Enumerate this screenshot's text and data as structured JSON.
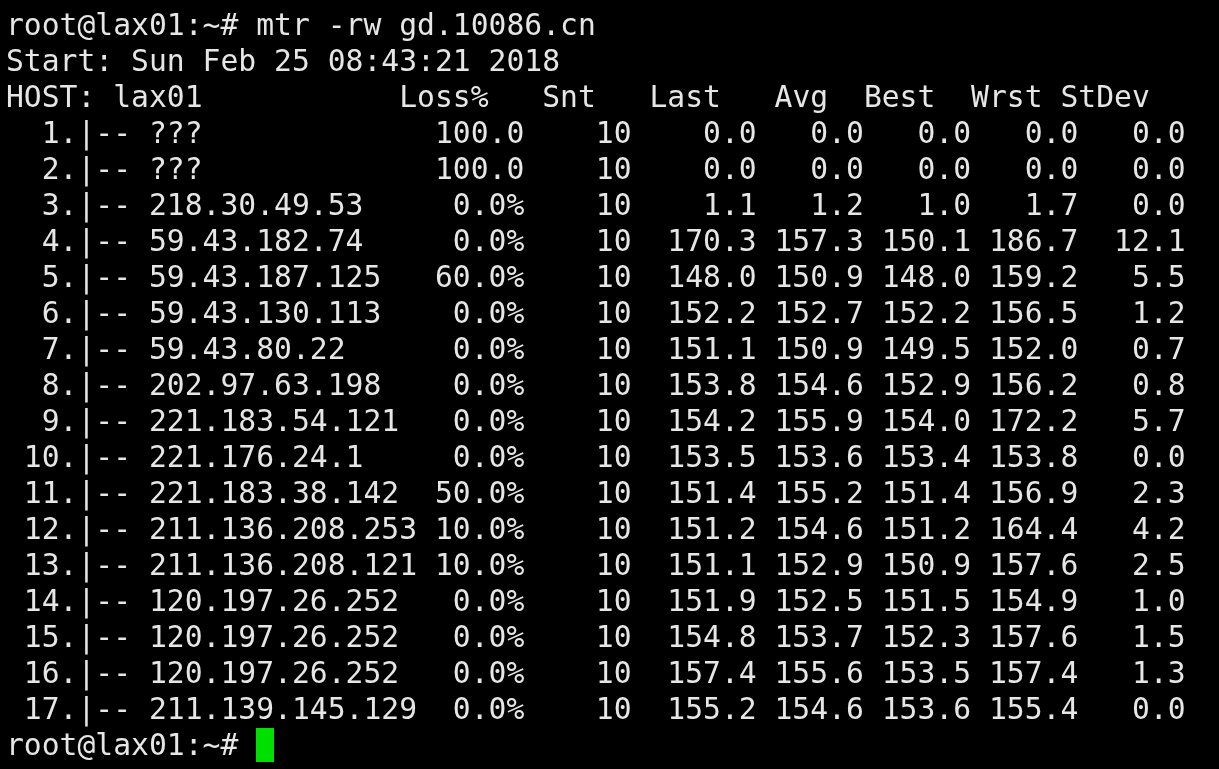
{
  "terminal": {
    "lines": [
      {
        "kind": "command",
        "prompt": "root@lax01:~#",
        "command": "mtr -rw gd.10086.cn"
      },
      {
        "kind": "text",
        "text": "Start: Sun Feb 25 08:43:21 2018"
      }
    ],
    "report": {
      "host_label": "HOST: lax01",
      "columns": [
        "Loss%",
        "Snt",
        "Last",
        "Avg",
        "Best",
        "Wrst",
        "StDev"
      ],
      "rows": [
        {
          "hop": "1.|--",
          "host": "???",
          "values": [
            "100.0",
            "10",
            "0.0",
            "0.0",
            "0.0",
            "0.0",
            "0.0"
          ]
        },
        {
          "hop": "2.|--",
          "host": "???",
          "values": [
            "100.0",
            "10",
            "0.0",
            "0.0",
            "0.0",
            "0.0",
            "0.0"
          ]
        },
        {
          "hop": "3.|--",
          "host": "218.30.49.53",
          "values": [
            "0.0%",
            "10",
            "1.1",
            "1.2",
            "1.0",
            "1.7",
            "0.0"
          ]
        },
        {
          "hop": "4.|--",
          "host": "59.43.182.74",
          "values": [
            "0.0%",
            "10",
            "170.3",
            "157.3",
            "150.1",
            "186.7",
            "12.1"
          ]
        },
        {
          "hop": "5.|--",
          "host": "59.43.187.125",
          "values": [
            "60.0%",
            "10",
            "148.0",
            "150.9",
            "148.0",
            "159.2",
            "5.5"
          ]
        },
        {
          "hop": "6.|--",
          "host": "59.43.130.113",
          "values": [
            "0.0%",
            "10",
            "152.2",
            "152.7",
            "152.2",
            "156.5",
            "1.2"
          ]
        },
        {
          "hop": "7.|--",
          "host": "59.43.80.22",
          "values": [
            "0.0%",
            "10",
            "151.1",
            "150.9",
            "149.5",
            "152.0",
            "0.7"
          ]
        },
        {
          "hop": "8.|--",
          "host": "202.97.63.198",
          "values": [
            "0.0%",
            "10",
            "153.8",
            "154.6",
            "152.9",
            "156.2",
            "0.8"
          ]
        },
        {
          "hop": "9.|--",
          "host": "221.183.54.121",
          "values": [
            "0.0%",
            "10",
            "154.2",
            "155.9",
            "154.0",
            "172.2",
            "5.7"
          ]
        },
        {
          "hop": "10.|--",
          "host": "221.176.24.1",
          "values": [
            "0.0%",
            "10",
            "153.5",
            "153.6",
            "153.4",
            "153.8",
            "0.0"
          ]
        },
        {
          "hop": "11.|--",
          "host": "221.183.38.142",
          "values": [
            "50.0%",
            "10",
            "151.4",
            "155.2",
            "151.4",
            "156.9",
            "2.3"
          ]
        },
        {
          "hop": "12.|--",
          "host": "211.136.208.253",
          "values": [
            "10.0%",
            "10",
            "151.2",
            "154.6",
            "151.2",
            "164.4",
            "4.2"
          ]
        },
        {
          "hop": "13.|--",
          "host": "211.136.208.121",
          "values": [
            "10.0%",
            "10",
            "151.1",
            "152.9",
            "150.9",
            "157.6",
            "2.5"
          ]
        },
        {
          "hop": "14.|--",
          "host": "120.197.26.252",
          "values": [
            "0.0%",
            "10",
            "151.9",
            "152.5",
            "151.5",
            "154.9",
            "1.0"
          ]
        },
        {
          "hop": "15.|--",
          "host": "120.197.26.252",
          "values": [
            "0.0%",
            "10",
            "154.8",
            "153.7",
            "152.3",
            "157.6",
            "1.5"
          ]
        },
        {
          "hop": "16.|--",
          "host": "120.197.26.252",
          "values": [
            "0.0%",
            "10",
            "157.4",
            "155.6",
            "153.5",
            "157.4",
            "1.3"
          ]
        },
        {
          "hop": "17.|--",
          "host": "211.139.145.129",
          "values": [
            "0.0%",
            "10",
            "155.2",
            "154.6",
            "153.6",
            "155.4",
            "0.0"
          ]
        }
      ]
    },
    "prompt": {
      "text": "root@lax01:~#",
      "cursor": true
    }
  }
}
